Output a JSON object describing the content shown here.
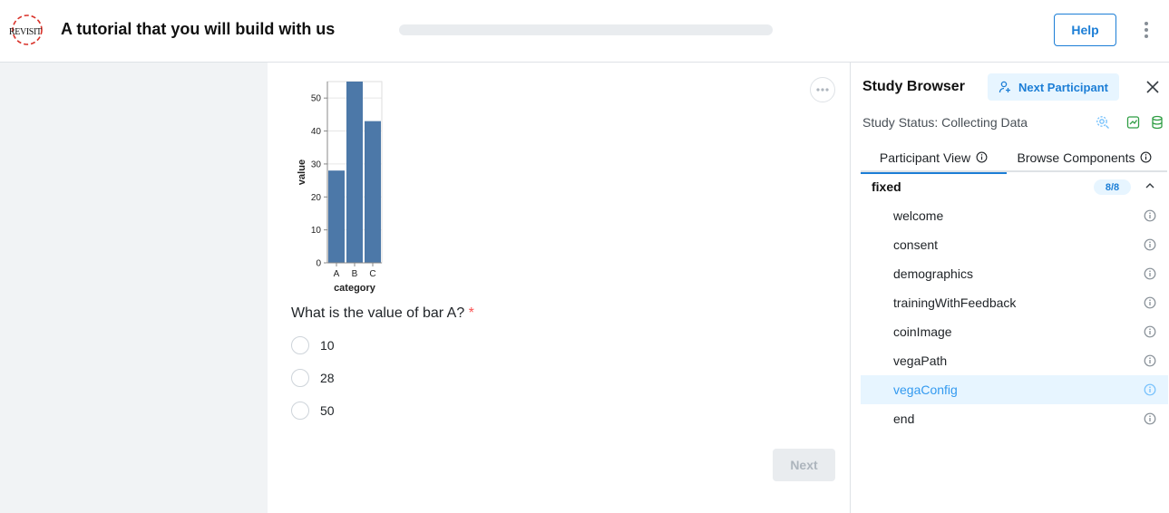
{
  "header": {
    "logo_text": "REVISIT",
    "title": "A tutorial that you will build with us",
    "progress": 0.0,
    "help_label": "Help"
  },
  "chart_data": {
    "type": "bar",
    "categories": [
      "A",
      "B",
      "C"
    ],
    "values": [
      28,
      55,
      43
    ],
    "xlabel": "category",
    "ylabel": "value",
    "yticks": [
      0,
      10,
      20,
      30,
      40,
      50
    ],
    "ylim": [
      0,
      55
    ],
    "grid": true,
    "bar_color": "#4c78a8"
  },
  "question": {
    "text": "What is the value of bar A?",
    "required_mark": "*",
    "options": [
      "10",
      "28",
      "50"
    ]
  },
  "next_label": "Next",
  "study_browser": {
    "title": "Study Browser",
    "next_participant_label": "Next Participant",
    "status_text": "Study Status: Collecting Data",
    "tabs": [
      "Participant View",
      "Browse Components"
    ],
    "group": {
      "name": "fixed",
      "badge": "8/8"
    },
    "items": [
      "welcome",
      "consent",
      "demographics",
      "trainingWithFeedback",
      "coinImage",
      "vegaPath",
      "vegaConfig",
      "end"
    ],
    "active_item": "vegaConfig"
  },
  "colors": {
    "accent": "#1c7ed6",
    "logo_red": "#d9322a",
    "green": "#2f9e44"
  }
}
